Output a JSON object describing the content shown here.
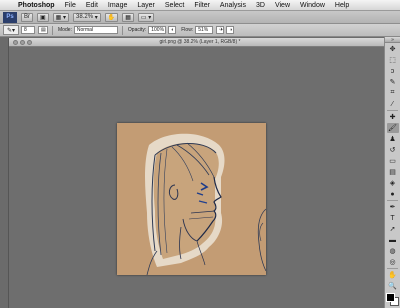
{
  "menubar": {
    "apple_glyph": "",
    "items": [
      "Photoshop",
      "File",
      "Edit",
      "Image",
      "Layer",
      "Select",
      "Filter",
      "Analysis",
      "3D",
      "View",
      "Window",
      "Help"
    ]
  },
  "appbar": {
    "logo": "Ps",
    "zoom": "38.2%",
    "arrange": "▦"
  },
  "options": {
    "brush_size": "8",
    "mode_label": "Mode:",
    "mode_value": "Normal",
    "opacity_label": "Opacity:",
    "opacity_value": "100%",
    "flow_label": "Flow:",
    "flow_value": "51%"
  },
  "document": {
    "title": "girl.png @ 38.2% (Layer 1, RGB/8) *"
  },
  "tools": [
    {
      "name": "move-tool",
      "glyph": "✥"
    },
    {
      "name": "marquee-tool",
      "glyph": "⬚"
    },
    {
      "name": "lasso-tool",
      "glyph": "ↄ"
    },
    {
      "name": "quick-select-tool",
      "glyph": "✎"
    },
    {
      "name": "crop-tool",
      "glyph": "⌗"
    },
    {
      "name": "eyedropper-tool",
      "glyph": "⁄"
    },
    {
      "name": "healing-tool",
      "glyph": "✚"
    },
    {
      "name": "brush-tool",
      "glyph": "🖌",
      "active": true
    },
    {
      "name": "clone-stamp-tool",
      "glyph": "♟"
    },
    {
      "name": "history-brush-tool",
      "glyph": "↺"
    },
    {
      "name": "eraser-tool",
      "glyph": "▭"
    },
    {
      "name": "gradient-tool",
      "glyph": "▤"
    },
    {
      "name": "blur-tool",
      "glyph": "◈"
    },
    {
      "name": "dodge-tool",
      "glyph": "●"
    },
    {
      "name": "pen-tool",
      "glyph": "✒"
    },
    {
      "name": "type-tool",
      "glyph": "T"
    },
    {
      "name": "path-select-tool",
      "glyph": "➚"
    },
    {
      "name": "shape-tool",
      "glyph": "▬"
    },
    {
      "name": "3d-rotate-tool",
      "glyph": "◍"
    },
    {
      "name": "3d-orbit-tool",
      "glyph": "◎"
    },
    {
      "name": "hand-tool",
      "glyph": "✋"
    },
    {
      "name": "zoom-tool",
      "glyph": "🔍"
    }
  ],
  "colors": {
    "foreground": "#000000",
    "background": "#ffffff",
    "canvas_paper": "#c09a73",
    "workspace": "#6b6b6b"
  }
}
